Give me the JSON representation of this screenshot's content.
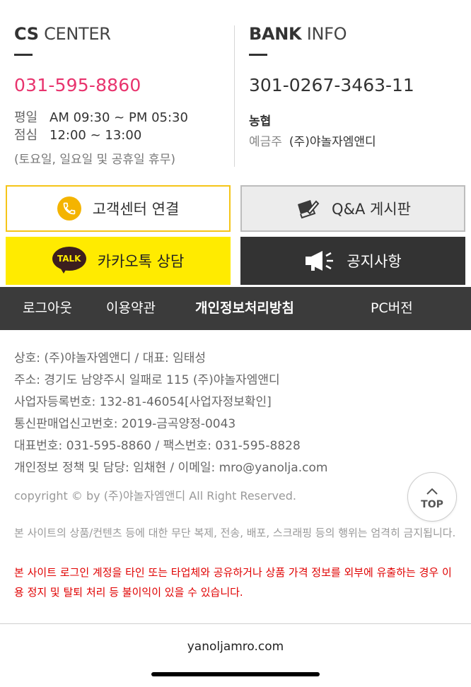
{
  "cs": {
    "title_bold": "CS",
    "title_rest": " CENTER",
    "phone": "031-595-8860",
    "weekday_label": "평일",
    "weekday_hours": "AM 09:30 ~ PM 05:30",
    "lunch_label": "점심",
    "lunch_hours": "12:00 ~ 13:00",
    "holiday_note": "(토요일, 일요일 및 공휴일 휴무)"
  },
  "bank": {
    "title_bold": "BANK",
    "title_rest": " INFO",
    "account": "301-0267-3463-11",
    "bank_name": "농협",
    "holder_label": "예금주",
    "holder_name": "(주)야놀자엠앤디"
  },
  "buttons": {
    "cs_connect": "고객센터 연결",
    "qa_board": "Q&A 게시판",
    "kakao": "카카오톡 상담",
    "kakao_badge": "TALK",
    "notice": "공지사항"
  },
  "nav": {
    "logout": "로그아웃",
    "terms": "이용약관",
    "privacy": "개인정보처리방침",
    "pc": "PC버전"
  },
  "company": {
    "line1": "상호: (주)야놀자엠앤디 / 대표: 임태성",
    "line2": "주소: 경기도 남양주시 일패로 115 (주)야놀자엠앤디",
    "line3": "사업자등록번호: 132-81-46054[사업자정보확인]",
    "line4": "통신판매업신고번호: 2019-금곡양정-0043",
    "line5": "대표번호: 031-595-8860 / 팩스번호: 031-595-8828",
    "line6": "개인정보 정책 및 담당: 임채현 / 이메일: mro@yanolja.com",
    "copyright": "copyright © by (주)야놀자엠앤디 All Right Reserved."
  },
  "top_button": "TOP",
  "notices": {
    "gray": "본 사이트의 상품/컨텐츠 등에 대한 무단 복제, 전송, 배포, 스크래핑 등의 행위는 엄격히 금지됩니다.",
    "red": "본 사이트 로그인 계정을 타인 또는 타업체와 공유하거나 상품 가격 정보를 외부에 유출하는 경우 이용 정지 및 탈퇴 처리 등 불이익이 있을 수 있습니다."
  },
  "domain": "yanoljamro.com",
  "colors": {
    "phone_pink": "#e8336d",
    "kakao_yellow": "#ffeb00",
    "cs_border": "#f5c518",
    "nav_bg": "#3b3b3b",
    "warning_red": "#e00000"
  },
  "icons": {
    "cs_connect": "phone-circle-icon",
    "qa_board": "edit-note-icon",
    "kakao": "kakaotalk-icon",
    "notice": "megaphone-icon",
    "top": "chevron-up-icon"
  }
}
